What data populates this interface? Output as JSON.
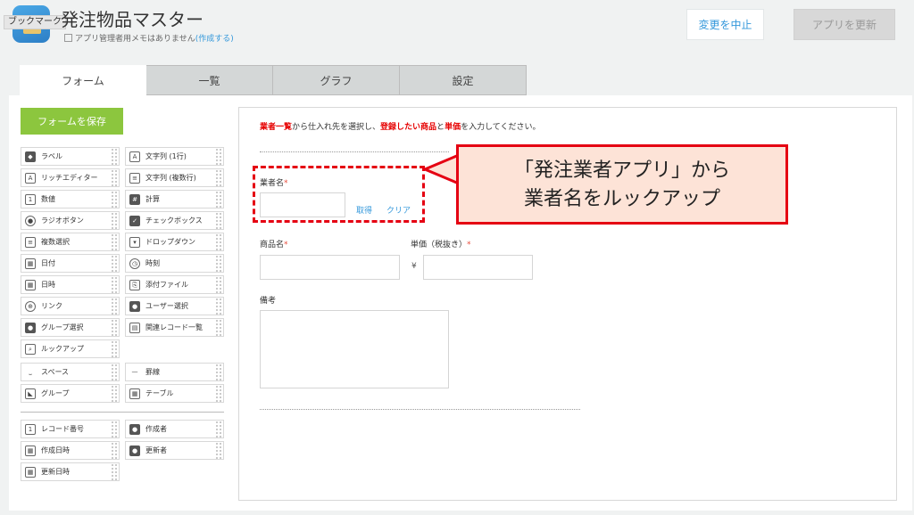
{
  "header": {
    "bookmark_label": "ブックマーク",
    "app_title": "発注物品マスター",
    "memo_text": "アプリ管理者用メモはありません",
    "memo_link": "(作成する)",
    "cancel_label": "変更を中止",
    "update_label": "アプリを更新"
  },
  "tabs": [
    {
      "label": "フォーム",
      "active": true
    },
    {
      "label": "一覧"
    },
    {
      "label": "グラフ"
    },
    {
      "label": "設定"
    }
  ],
  "palette": {
    "save_label": "フォームを保存",
    "items": [
      {
        "label": "ラベル",
        "icon": "tag-icon"
      },
      {
        "label": "文字列 (1行)",
        "icon": "single-line-text-icon"
      },
      {
        "label": "リッチエディター",
        "icon": "rich-editor-icon"
      },
      {
        "label": "文字列 (複数行)",
        "icon": "multi-line-text-icon"
      },
      {
        "label": "数値",
        "icon": "number-icon"
      },
      {
        "label": "計算",
        "icon": "calculator-icon"
      },
      {
        "label": "ラジオボタン",
        "icon": "radio-icon"
      },
      {
        "label": "チェックボックス",
        "icon": "checkbox-icon"
      },
      {
        "label": "複数選択",
        "icon": "multi-select-icon"
      },
      {
        "label": "ドロップダウン",
        "icon": "dropdown-icon"
      },
      {
        "label": "日付",
        "icon": "date-icon"
      },
      {
        "label": "時刻",
        "icon": "clock-icon"
      },
      {
        "label": "日時",
        "icon": "datetime-icon"
      },
      {
        "label": "添付ファイル",
        "icon": "paperclip-icon"
      },
      {
        "label": "リンク",
        "icon": "link-icon"
      },
      {
        "label": "ユーザー選択",
        "icon": "user-icon"
      },
      {
        "label": "グループ選択",
        "icon": "group-icon"
      },
      {
        "label": "関連レコード一覧",
        "icon": "related-records-icon"
      },
      {
        "label": "ルックアップ",
        "icon": "lookup-icon"
      },
      {
        "label": "スペース",
        "icon": "space-icon"
      },
      {
        "label": "罫線",
        "icon": "rule-line-icon"
      },
      {
        "label": "グループ",
        "icon": "group-folder-icon"
      },
      {
        "label": "テーブル",
        "icon": "table-icon"
      },
      {
        "label": "レコード番号",
        "icon": "record-number-icon"
      },
      {
        "label": "作成者",
        "icon": "creator-icon"
      },
      {
        "label": "作成日時",
        "icon": "created-datetime-icon"
      },
      {
        "label": "更新者",
        "icon": "updater-icon"
      },
      {
        "label": "更新日時",
        "icon": "updated-datetime-icon"
      }
    ]
  },
  "form": {
    "instruction": {
      "part1": "業者一覧",
      "part2": "から仕入れ先を選択し、",
      "part3": "登録したい商品",
      "part4": "と",
      "part5": "単価",
      "part6": "を入力してください。"
    },
    "vendor_label": "業者名",
    "required_mark": "*",
    "fetch_label": "取得",
    "clear_label": "クリア",
    "product_label": "商品名",
    "price_label": "単価（税抜き）",
    "yen": "¥",
    "notes_label": "備考"
  },
  "callout": {
    "line1": "「発注業者アプリ」から",
    "line2": "業者名をルックアップ"
  },
  "colors": {
    "accent": "#3498db",
    "save_green": "#8cc63e",
    "highlight_red": "#e50012",
    "callout_bg": "#fde3d7"
  }
}
